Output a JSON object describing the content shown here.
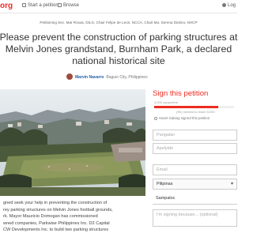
{
  "header": {
    "logo": "org",
    "start_petition": "Start a petition",
    "browse": "Browse",
    "login": "Log"
  },
  "petition": {
    "petitioning": "Petitioning Sec. Mar Roxas, DILG, Chair Felipe de Leon, NCCA, Chair Ma. Serena Diokno, NHCP",
    "title": "Please prevent the construction of parking structures at Melvin Jones grandstand, Burnham Park, a declared national historical site",
    "author_name": "Marvin Navarro",
    "author_location": "Baguio City, Philippines",
    "body_lines": [
      "gned seek your help in preventing the construction of",
      "rey parking structures on Melvin Jones football grounds,",
      "rk. Mayor Mauricio Domogan has commissioned",
      "wned companies, Parkwise Philippines Inc. D2 Capital",
      "CW Developments Inc. to build two parking structures"
    ]
  },
  "sign": {
    "heading": "Sign this petition",
    "supporters": "4,000 supporters",
    "needed": "(9K) needed to reach 5,000",
    "recent_signer": "Hazel Galang signed this petition",
    "progress": 0.8,
    "first_name_placeholder": "Pangalan",
    "last_name_placeholder": "Apelyido",
    "email_placeholder": "Email",
    "country": "Pilipinas",
    "city": "Sampaloc",
    "reason_placeholder": "I'm signing because... (optional)"
  },
  "colors": {
    "brand": "#ec2c22",
    "link": "#1a5fa8"
  }
}
